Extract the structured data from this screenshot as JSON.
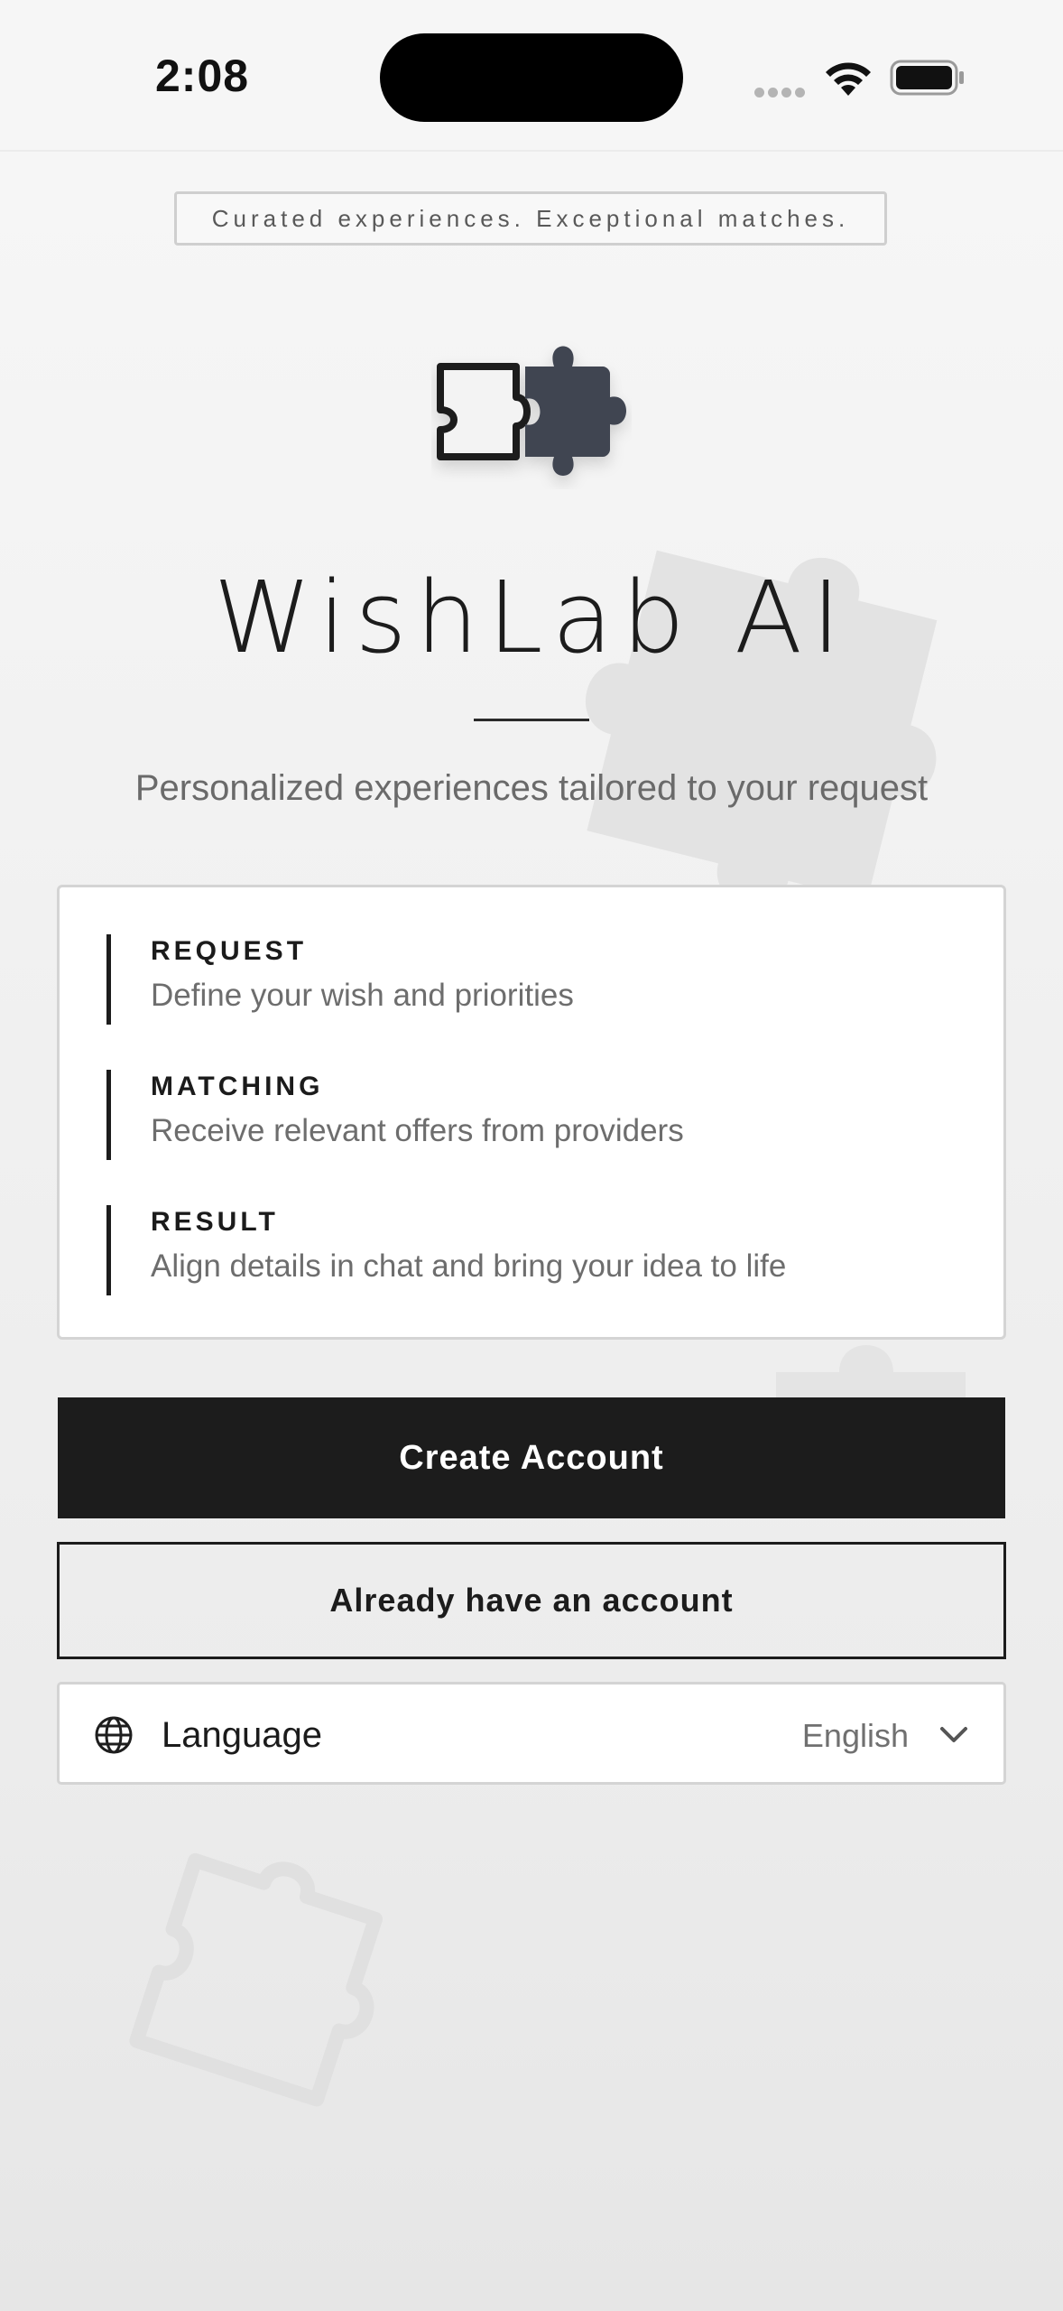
{
  "status_bar": {
    "time": "2:08"
  },
  "tagline": "Curated experiences. Exceptional matches.",
  "app": {
    "title": "WishLab AI",
    "subtitle": "Personalized experiences tailored to your request",
    "logo_icon": "puzzle-pieces-icon"
  },
  "steps": [
    {
      "title": "REQUEST",
      "description": "Define your wish and priorities"
    },
    {
      "title": "MATCHING",
      "description": "Receive relevant offers from providers"
    },
    {
      "title": "RESULT",
      "description": "Align details in chat and bring your idea to life"
    }
  ],
  "buttons": {
    "create_account": "Create Account",
    "sign_in": "Already have an account"
  },
  "language": {
    "label": "Language",
    "value": "English",
    "icon": "globe-icon"
  },
  "colors": {
    "primary": "#1c1c1c",
    "puzzle_piece": "#3f4451",
    "background": "#f1f1f1"
  }
}
